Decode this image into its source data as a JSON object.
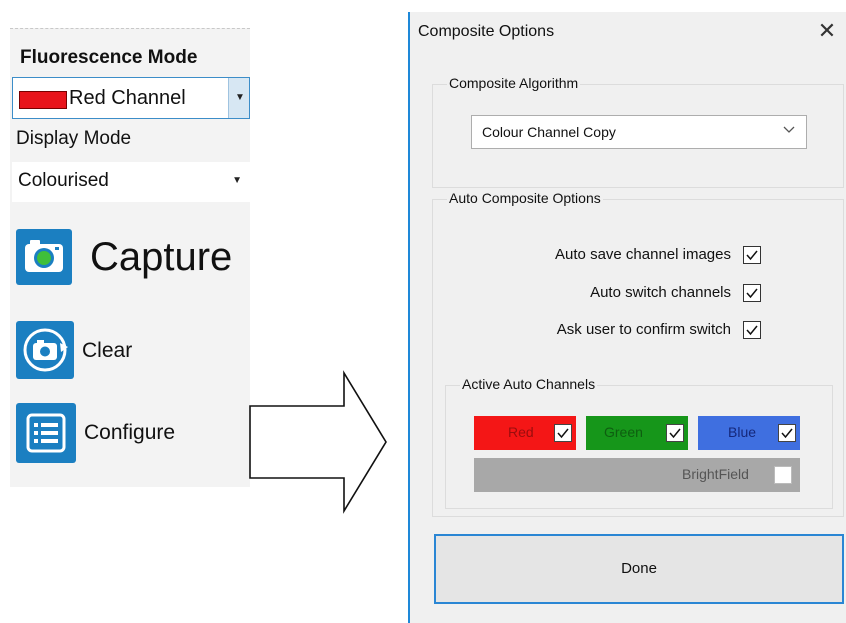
{
  "left_panel": {
    "fluorescence_title": "Fluorescence Mode",
    "channel_value": "Red Channel",
    "channel_color": "#e8141b",
    "display_label": "Display Mode",
    "display_value": "Colourised",
    "capture_label": "Capture",
    "clear_label": "Clear",
    "configure_label": "Configure"
  },
  "dialog": {
    "title": "Composite Options",
    "close_glyph": "✕",
    "algorithm_group_label": "Composite Algorithm",
    "algorithm_value": "Colour Channel Copy",
    "auto_group_label": "Auto Composite Options",
    "options": [
      {
        "label": "Auto save channel images",
        "checked": true
      },
      {
        "label": "Auto switch channels",
        "checked": true
      },
      {
        "label": "Ask user to confirm switch",
        "checked": true
      }
    ],
    "channels_group_label": "Active Auto Channels",
    "channels": [
      {
        "label": "Red",
        "checked": true,
        "color": "#f41616"
      },
      {
        "label": "Green",
        "checked": true,
        "color": "#16961a"
      },
      {
        "label": "Blue",
        "checked": true,
        "color": "#3f6fe0"
      },
      {
        "label": "BrightField",
        "checked": false,
        "color": "#a8a8a8"
      }
    ],
    "done_label": "Done"
  }
}
